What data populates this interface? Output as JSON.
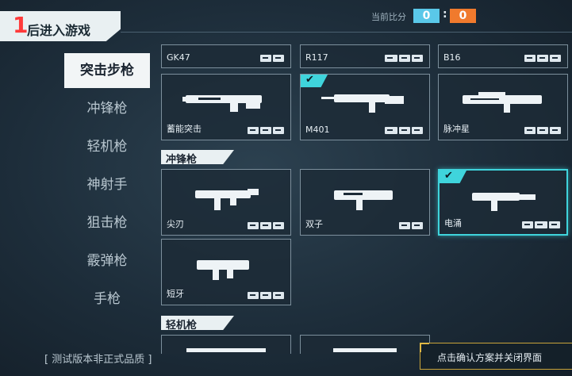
{
  "header": {
    "round_number": "1",
    "round_text": "后进入游戏",
    "score_label": "当前比分",
    "score_left": "0",
    "score_sep": ":",
    "score_right": "0",
    "colors": {
      "score_left": "#5ac8e9",
      "score_right": "#f07a2d",
      "accent_cyan": "#3fd4dc",
      "accent_gold": "#c9a43a"
    }
  },
  "sidebar": {
    "items": [
      {
        "label": "突击步枪",
        "active": true
      },
      {
        "label": "冲锋枪"
      },
      {
        "label": "轻机枪"
      },
      {
        "label": "神射手"
      },
      {
        "label": "狙击枪"
      },
      {
        "label": "霰弹枪"
      },
      {
        "label": "手枪"
      }
    ]
  },
  "rifles_row0": [
    {
      "name": "GK47"
    },
    {
      "name": "R117"
    },
    {
      "name": "B16"
    }
  ],
  "rifles_row1": [
    {
      "name": "蓄能突击"
    },
    {
      "name": "M401",
      "selected_check": true
    },
    {
      "name": "脉冲星"
    }
  ],
  "smg_section": {
    "title": "冲锋枪"
  },
  "smg_row0": [
    {
      "name": "尖刃"
    },
    {
      "name": "双子"
    },
    {
      "name": "电涌",
      "selected": true
    }
  ],
  "smg_row1": [
    {
      "name": "短牙"
    }
  ],
  "lmg_section": {
    "title": "轻机枪"
  },
  "footer": {
    "version_notice": "[ 测试版本非正式品质 ]",
    "confirm_label": "点击确认方案并关闭界面"
  }
}
